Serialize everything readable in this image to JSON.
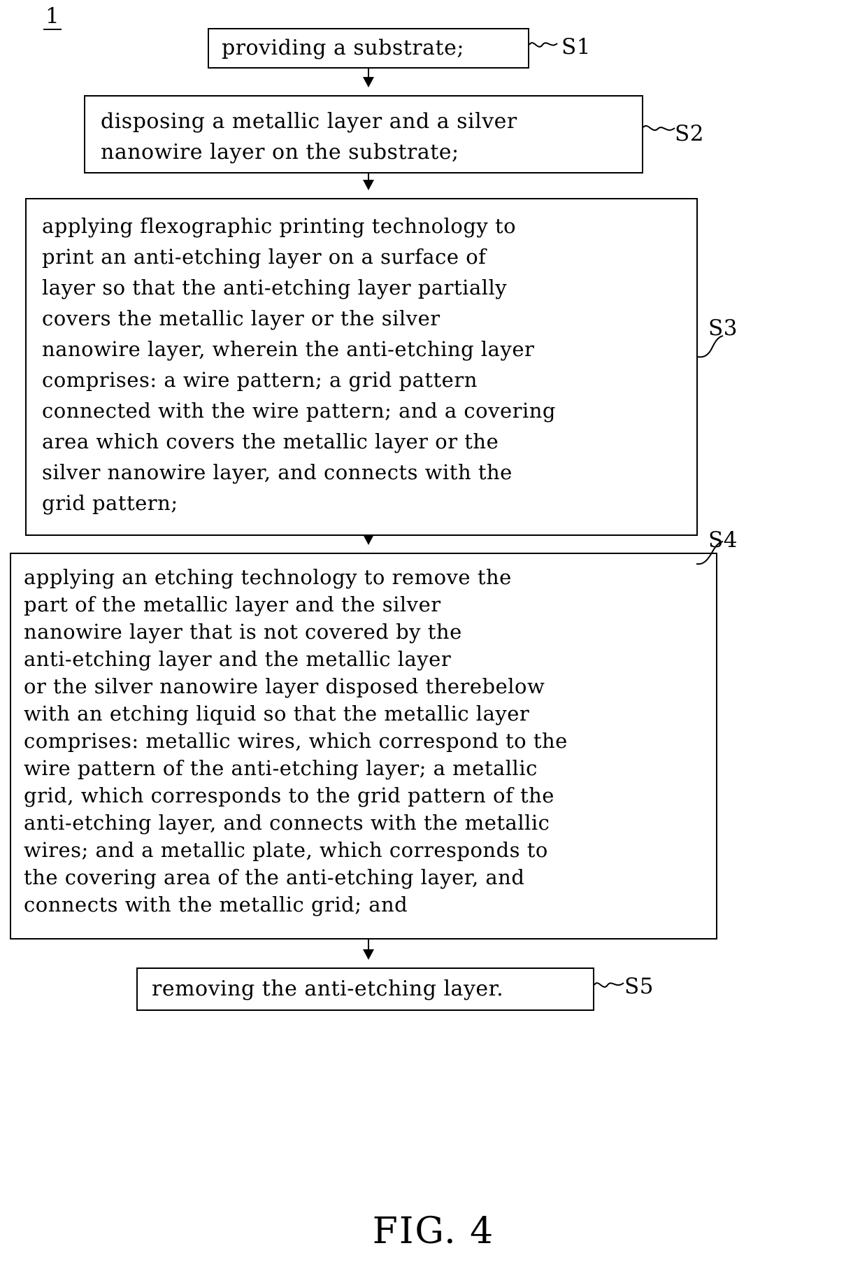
{
  "figure": {
    "reference_numeral": "1",
    "caption": "FIG. 4"
  },
  "steps": [
    {
      "id": "S1",
      "label": "S1",
      "text": "providing a substrate;"
    },
    {
      "id": "S2",
      "label": "S2",
      "text": "disposing a metallic layer and a silver\nnanowire layer on the substrate;"
    },
    {
      "id": "S3",
      "label": "S3",
      "text": "applying flexographic printing technology to\nprint an anti-etching layer on a surface of\nlayer so that the anti-etching layer partially\ncovers the metallic layer or the silver\nnanowire layer, wherein the anti-etching layer\ncomprises: a wire pattern; a grid pattern\nconnected with the wire pattern; and a covering\narea which covers the metallic layer or the\nsilver nanowire layer, and connects with the\ngrid pattern;"
    },
    {
      "id": "S4",
      "label": "S4",
      "text": "applying an etching technology to remove the\npart of the metallic layer and the silver\nnanowire layer that is not covered by the\nanti-etching layer and the metallic layer\nor the silver nanowire layer disposed therebelow\nwith an etching liquid so that the metallic layer\ncomprises: metallic wires, which correspond to the\nwire pattern of the anti-etching layer; a metallic\ngrid, which corresponds to the grid pattern of the\nanti-etching layer, and connects with the metallic\nwires; and a metallic plate, which corresponds to\nthe covering area of the anti-etching layer, and\nconnects with the metallic grid; and"
    },
    {
      "id": "S5",
      "label": "S5",
      "text": "removing the anti-etching layer."
    }
  ],
  "colors": {
    "ink": "#000000",
    "paper": "#ffffff"
  }
}
